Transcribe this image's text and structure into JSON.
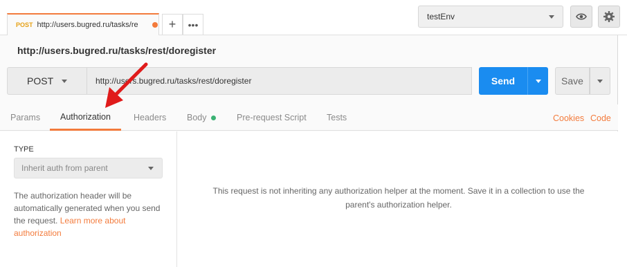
{
  "tab": {
    "method": "POST",
    "url_truncated": "http://users.bugred.ru/tasks/re"
  },
  "environment": {
    "selected": "testEnv"
  },
  "request": {
    "name": "http://users.bugred.ru/tasks/rest/doregister",
    "method": "POST",
    "url": "http://users.bugred.ru/tasks/rest/doregister",
    "send_label": "Send",
    "save_label": "Save"
  },
  "request_tabs": {
    "params": "Params",
    "authorization": "Authorization",
    "headers": "Headers",
    "body": "Body",
    "prerequest": "Pre-request Script",
    "tests": "Tests",
    "cookies": "Cookies",
    "code": "Code"
  },
  "auth": {
    "type_label": "TYPE",
    "type_selected": "Inherit auth from parent",
    "description": "The authorization header will be automatically generated when you send the request.",
    "learn_more": "Learn more about authorization",
    "message": "This request is not inheriting any authorization helper at the moment. Save it in a collection to use the parent's authorization helper."
  },
  "colors": {
    "accent": "#f37b3c",
    "send_blue": "#1a8cf0",
    "arrow_red": "#e01b1b",
    "body_dot": "#3bb273"
  }
}
